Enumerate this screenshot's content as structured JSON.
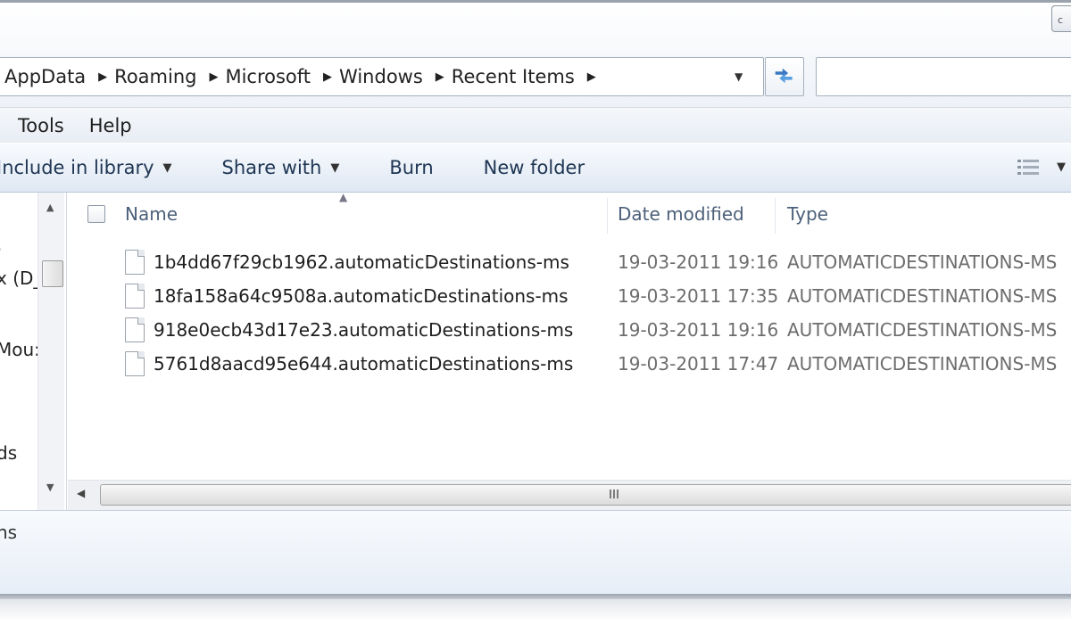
{
  "titlebar": {
    "button_label": "c"
  },
  "address": {
    "crumbs": [
      "AppData",
      "Roaming",
      "Microsoft",
      "Windows",
      "Recent Items"
    ],
    "search_value": ""
  },
  "menu": [
    "Tools",
    "Help"
  ],
  "commands": {
    "include_label": "Include in library",
    "share_label": "Share with",
    "burn_label": "Burn",
    "new_folder_label": "New folder"
  },
  "nav": {
    "items": [
      "x (D_",
      "Mou:",
      "ds"
    ]
  },
  "columns": {
    "name": "Name",
    "date": "Date modified",
    "type": "Type"
  },
  "files": [
    {
      "name": "1b4dd67f29cb1962.automaticDestinations-ms",
      "date": "19-03-2011 19:16",
      "type": "AUTOMATICDESTINATIONS-MS"
    },
    {
      "name": "18fa158a64c9508a.automaticDestinations-ms",
      "date": "19-03-2011 17:35",
      "type": "AUTOMATICDESTINATIONS-MS"
    },
    {
      "name": "918e0ecb43d17e23.automaticDestinations-ms",
      "date": "19-03-2011 19:16",
      "type": "AUTOMATICDESTINATIONS-MS"
    },
    {
      "name": "5761d8aacd95e644.automaticDestinations-ms",
      "date": "19-03-2011 17:47",
      "type": "AUTOMATICDESTINATIONS-MS"
    }
  ],
  "details": {
    "text": "ns"
  },
  "icons": {
    "crumb_separator": "chevron-right-icon",
    "refresh": "refresh-icon",
    "dropdown": "chevron-down-icon",
    "file": "file-icon",
    "view": "view-details-icon"
  },
  "colors": {
    "command_text": "#1e3553",
    "column_header_text": "#4c607a",
    "secondary_text": "#6d6d6d"
  }
}
